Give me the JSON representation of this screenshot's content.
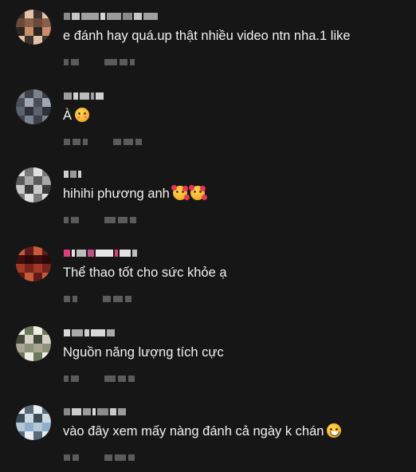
{
  "comments": [
    {
      "text": "e đánh hay quá.up thật nhiều video ntn nha.1 like",
      "emojis": [],
      "avatar_colors": [
        "#3a3330",
        "#c98d6a",
        "#8a5e48",
        "#e3c2a8",
        "#2b2624",
        "#6b4a3a"
      ],
      "name_colors": [
        "#8a8a8a",
        "#c7c7c7",
        "#a0a0a0",
        "#d5d5d5",
        "#9b9b9b"
      ]
    },
    {
      "text": "À",
      "emojis": [
        "face-savoring-food-emoji"
      ],
      "avatar_colors": [
        "#4a4e57",
        "#7a8290",
        "#2e3138",
        "#a0a8b5",
        "#3c4048",
        "#5d636e"
      ],
      "name_colors": [
        "#9d9d9d",
        "#d0d0d0",
        "#bbbbbb"
      ]
    },
    {
      "text": "hihihi phương anh",
      "emojis": [
        "smiling-face-with-hearts-emoji",
        "smiling-face-with-hearts-emoji"
      ],
      "avatar_colors": [
        "#c9c9c9",
        "#5a5a5a",
        "#e0e0e0",
        "#3a3a3a",
        "#a8a8a8",
        "#7a7a7a"
      ],
      "name_colors": [
        "#cfcfcf",
        "#999999"
      ]
    },
    {
      "text": "Thể thao tốt cho sức khỏe ạ",
      "emojis": [],
      "avatar_colors": [
        "#5e1a17",
        "#a33a28",
        "#3b0f0d",
        "#c65b3a",
        "#7a231c",
        "#2d0a09"
      ],
      "name_colors": [
        "#d9407a",
        "#e2e2e2",
        "#bdbdbd",
        "#c44d8a",
        "#e6e6e6"
      ]
    },
    {
      "text": "Nguồn năng lượng tích cực",
      "emojis": [],
      "avatar_colors": [
        "#d6d2c8",
        "#6b7a5a",
        "#a9a494",
        "#434a3a",
        "#efece4",
        "#8b9378"
      ],
      "name_colors": [
        "#d8d8d8",
        "#a9a9a9",
        "#cfcfcf"
      ]
    },
    {
      "text": "vào đây xem mấy nàng đánh cả ngày k chán",
      "emojis": [
        "grinning-face-with-sweat-emoji"
      ],
      "avatar_colors": [
        "#8fb0cc",
        "#cfd9e2",
        "#5a6b7c",
        "#b6c7d6",
        "#3e4c5a",
        "#e8eef3"
      ],
      "name_colors": [
        "#8a8a8a",
        "#cbcbcb",
        "#9a9a9a",
        "#dadada"
      ]
    }
  ],
  "meta_color": "#5b5b5b",
  "background_color": "#161616"
}
